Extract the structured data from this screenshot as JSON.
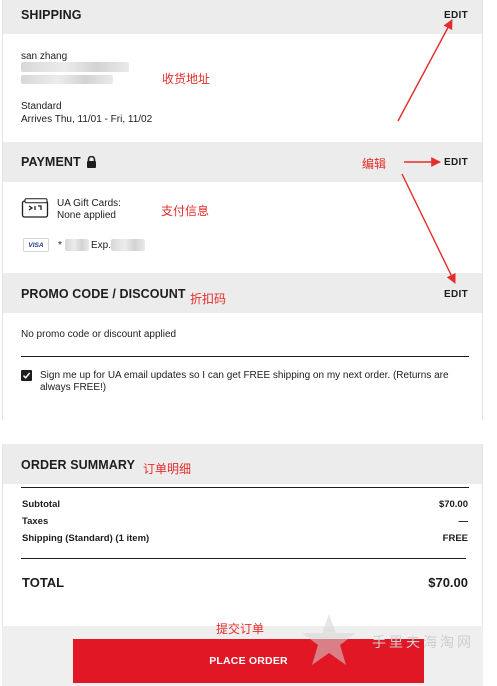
{
  "shipping": {
    "title": "SHIPPING",
    "edit_label": "EDIT",
    "name": "san zhang",
    "method": "Standard",
    "arrival": "Arrives Thu, 11/01 - Fri, 11/02"
  },
  "payment": {
    "title": "PAYMENT",
    "edit_label": "EDIT",
    "gift_card_label": "UA Gift Cards:",
    "gift_card_value": "None applied",
    "card_brand": "VISA",
    "card_number_prefix": "*",
    "card_expiry_label": "Exp."
  },
  "promo": {
    "title": "PROMO CODE / DISCOUNT",
    "edit_label": "EDIT",
    "status": "No promo code or discount applied",
    "signup_checked": true,
    "signup_text": "Sign me up for UA email updates so I can get FREE shipping on my next order. (Returns are always FREE!)"
  },
  "summary": {
    "title": "ORDER SUMMARY",
    "subtotal_label": "Subtotal",
    "subtotal_value": "$70.00",
    "taxes_label": "Taxes",
    "taxes_value": "—",
    "shipping_label": "Shipping (Standard) (1 item)",
    "shipping_value": "FREE",
    "total_label": "TOTAL",
    "total_value": "$70.00"
  },
  "place_order_label": "PLACE ORDER",
  "annotations": {
    "address": "收货地址",
    "edit": "编辑",
    "payment_info": "支付信息",
    "discount": "折扣码",
    "order_detail": "订单明细",
    "submit_order": "提交订单"
  },
  "watermark": "手里夫海淘网",
  "colors": {
    "accent_red": "#e11726",
    "annotation_red": "#e52b2b",
    "section_gray": "#ececec"
  }
}
